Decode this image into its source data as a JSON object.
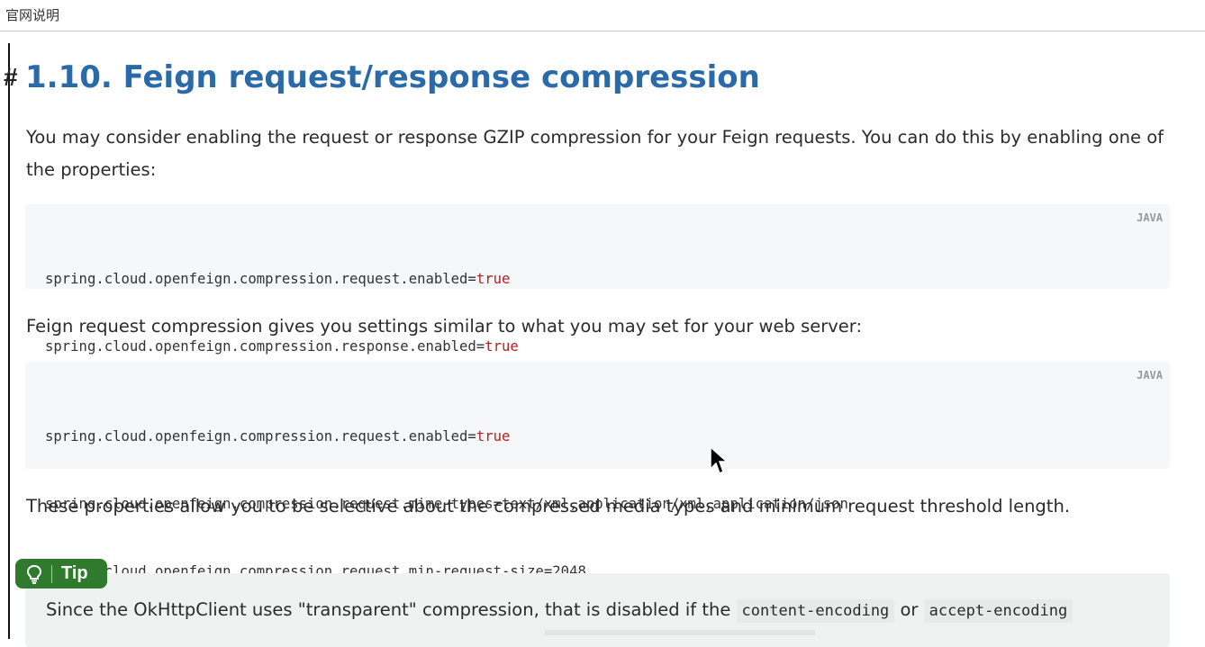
{
  "window": {
    "title": "官网说明"
  },
  "section": {
    "anchor": "#",
    "heading": "1.10. Feign request/response compression",
    "intro": "You may consider enabling the request or response GZIP compression for your Feign requests. You can do this by enabling one of the properties:",
    "code1": {
      "lang": "JAVA",
      "lines": [
        {
          "key": "spring.cloud.openfeign.compression.request.enabled=",
          "value": "true"
        },
        {
          "key": "spring.cloud.openfeign.compression.response.enabled=",
          "value": "true"
        }
      ]
    },
    "middle": "Feign request compression gives you settings similar to what you may set for your web server:",
    "code2": {
      "lang": "JAVA",
      "lines": [
        {
          "key": "spring.cloud.openfeign.compression.request.enabled=",
          "value": "true"
        },
        {
          "key": "spring.cloud.openfeign.compression.request.mime-types=text/xml,application/xml,application/json",
          "value": ""
        },
        {
          "key": "spring.cloud.openfeign.compression.request.min-request-size=2048",
          "value": ""
        }
      ]
    },
    "after": "These properties allow you to be selective about the compressed media types and minimum request threshold length.",
    "tip": {
      "icon": "lightbulb-icon",
      "label": "Tip",
      "text_before": "Since the OkHttpClient uses \"transparent\" compression, that is disabled if the ",
      "code_a": "content-encoding",
      "text_mid": " or ",
      "code_b": "accept-encoding"
    }
  },
  "colors": {
    "heading": "#2a6aa8",
    "keyword": "#b22222",
    "tip_badge": "#2f7a2c"
  }
}
